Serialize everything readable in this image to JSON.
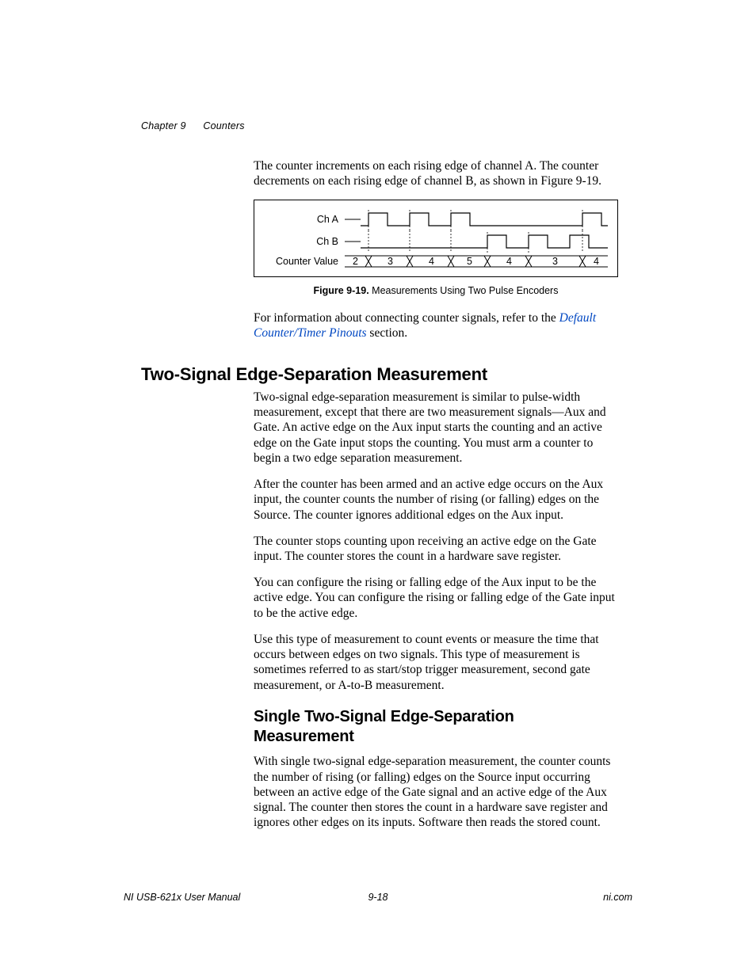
{
  "header": {
    "chapter": "Chapter 9",
    "section": "Counters"
  },
  "intro_para": "The counter increments on each rising edge of channel A. The counter decrements on each rising edge of channel B, as shown in Figure 9-19.",
  "figure": {
    "label_chA": "Ch A",
    "label_chB": "Ch B",
    "label_counter": "Counter Value",
    "values": {
      "v0": "2",
      "v1": "3",
      "v2": "4",
      "v3": "5",
      "v4": "4",
      "v5": "3",
      "v6": "4"
    },
    "caption_bold": "Figure 9-19.",
    "caption_rest": "  Measurements Using Two Pulse Encoders"
  },
  "info_para_pre": "For information about connecting counter signals, refer to the ",
  "info_link": "Default Counter/Timer Pinouts",
  "info_para_post": " section.",
  "h1": "Two-Signal Edge-Separation Measurement",
  "p1": "Two-signal edge-separation measurement is similar to pulse-width measurement, except that there are two measurement signals—Aux and Gate. An active edge on the Aux input starts the counting and an active edge on the Gate input stops the counting. You must arm a counter to begin a two edge separation measurement.",
  "p2": "After the counter has been armed and an active edge occurs on the Aux input, the counter counts the number of rising (or falling) edges on the Source. The counter ignores additional edges on the Aux input.",
  "p3": "The counter stops counting upon receiving an active edge on the Gate input. The counter stores the count in a hardware save register.",
  "p4": "You can configure the rising or falling edge of the Aux input to be the active edge. You can configure the rising or falling edge of the Gate input to be the active edge.",
  "p5": "Use this type of measurement to count events or measure the time that occurs between edges on two signals. This type of measurement is sometimes referred to as start/stop trigger measurement, second gate measurement, or A-to-B measurement.",
  "h2": "Single Two-Signal Edge-Separation Measurement",
  "p6": "With single two-signal edge-separation measurement, the counter counts the number of rising (or falling) edges on the Source input occurring between an active edge of the Gate signal and an active edge of the Aux signal. The counter then stores the count in a hardware save register and ignores other edges on its inputs. Software then reads the stored count.",
  "footer": {
    "left": "NI USB-621x User Manual",
    "center": "9-18",
    "right": "ni.com"
  },
  "chart_data": {
    "type": "timing-diagram",
    "title": "Measurements Using Two Pulse Encoders",
    "signals": [
      {
        "name": "Ch A",
        "rising_edges_effect": "increment",
        "pulses": 4
      },
      {
        "name": "Ch B",
        "rising_edges_effect": "decrement",
        "pulses": 3
      }
    ],
    "counter_sequence": [
      2,
      3,
      4,
      5,
      4,
      3,
      4
    ]
  }
}
